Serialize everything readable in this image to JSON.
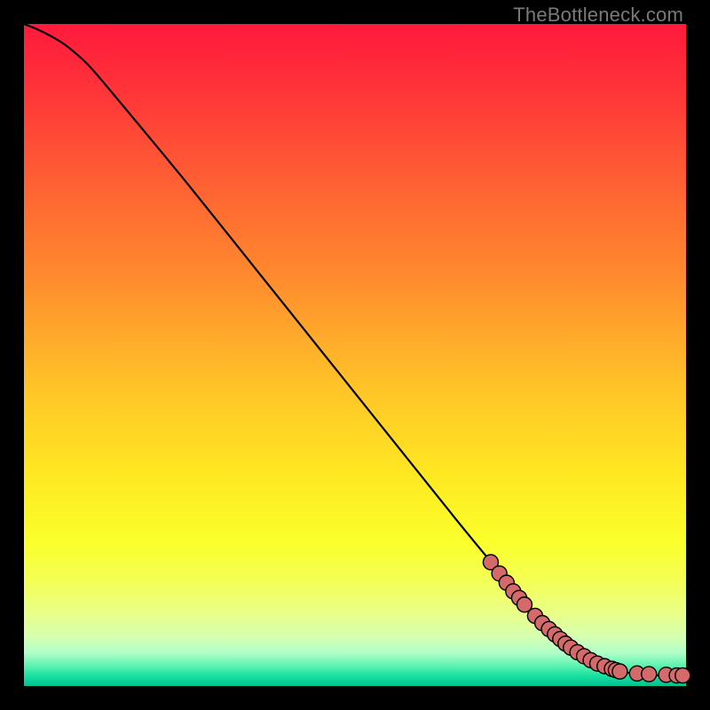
{
  "watermark": "TheBottleneck.com",
  "colors": {
    "curve": "#000000",
    "marker_fill": "#d46a6a",
    "marker_stroke": "#000000",
    "frame_bg_top": "#ff1a3c",
    "frame_bg_bottom": "#00c090"
  },
  "chart_data": {
    "type": "line",
    "title": "",
    "xlabel": "",
    "ylabel": "",
    "xlim": [
      0,
      100
    ],
    "ylim": [
      0,
      100
    ],
    "grid": false,
    "legend": false,
    "series": [
      {
        "name": "curve",
        "kind": "line",
        "x": [
          0,
          2,
          4,
          6,
          8,
          10,
          13,
          18,
          25,
          35,
          45,
          55,
          65,
          72,
          78,
          82,
          86,
          88,
          90,
          92,
          94,
          96,
          98,
          100
        ],
        "y": [
          100,
          99.2,
          98.2,
          97.0,
          95.4,
          93.5,
          90.0,
          84.0,
          75.5,
          63.0,
          50.5,
          38.0,
          25.5,
          17.0,
          10.0,
          6.5,
          3.8,
          2.8,
          2.2,
          1.9,
          1.7,
          1.6,
          1.6,
          1.6
        ]
      },
      {
        "name": "markers",
        "kind": "scatter",
        "x": [
          70.5,
          71.8,
          72.9,
          73.9,
          74.8,
          75.6,
          77.2,
          78.3,
          79.3,
          80.2,
          81.0,
          81.8,
          82.6,
          83.6,
          84.6,
          85.6,
          86.6,
          87.7,
          88.8,
          89.4,
          90.0,
          92.6,
          94.4,
          97.0,
          98.6,
          99.5
        ],
        "y": [
          18.7,
          17.0,
          15.6,
          14.3,
          13.3,
          12.3,
          10.6,
          9.5,
          8.6,
          7.8,
          7.1,
          6.4,
          5.8,
          5.1,
          4.5,
          3.9,
          3.4,
          3.0,
          2.6,
          2.4,
          2.2,
          1.9,
          1.8,
          1.7,
          1.6,
          1.6
        ]
      }
    ]
  }
}
